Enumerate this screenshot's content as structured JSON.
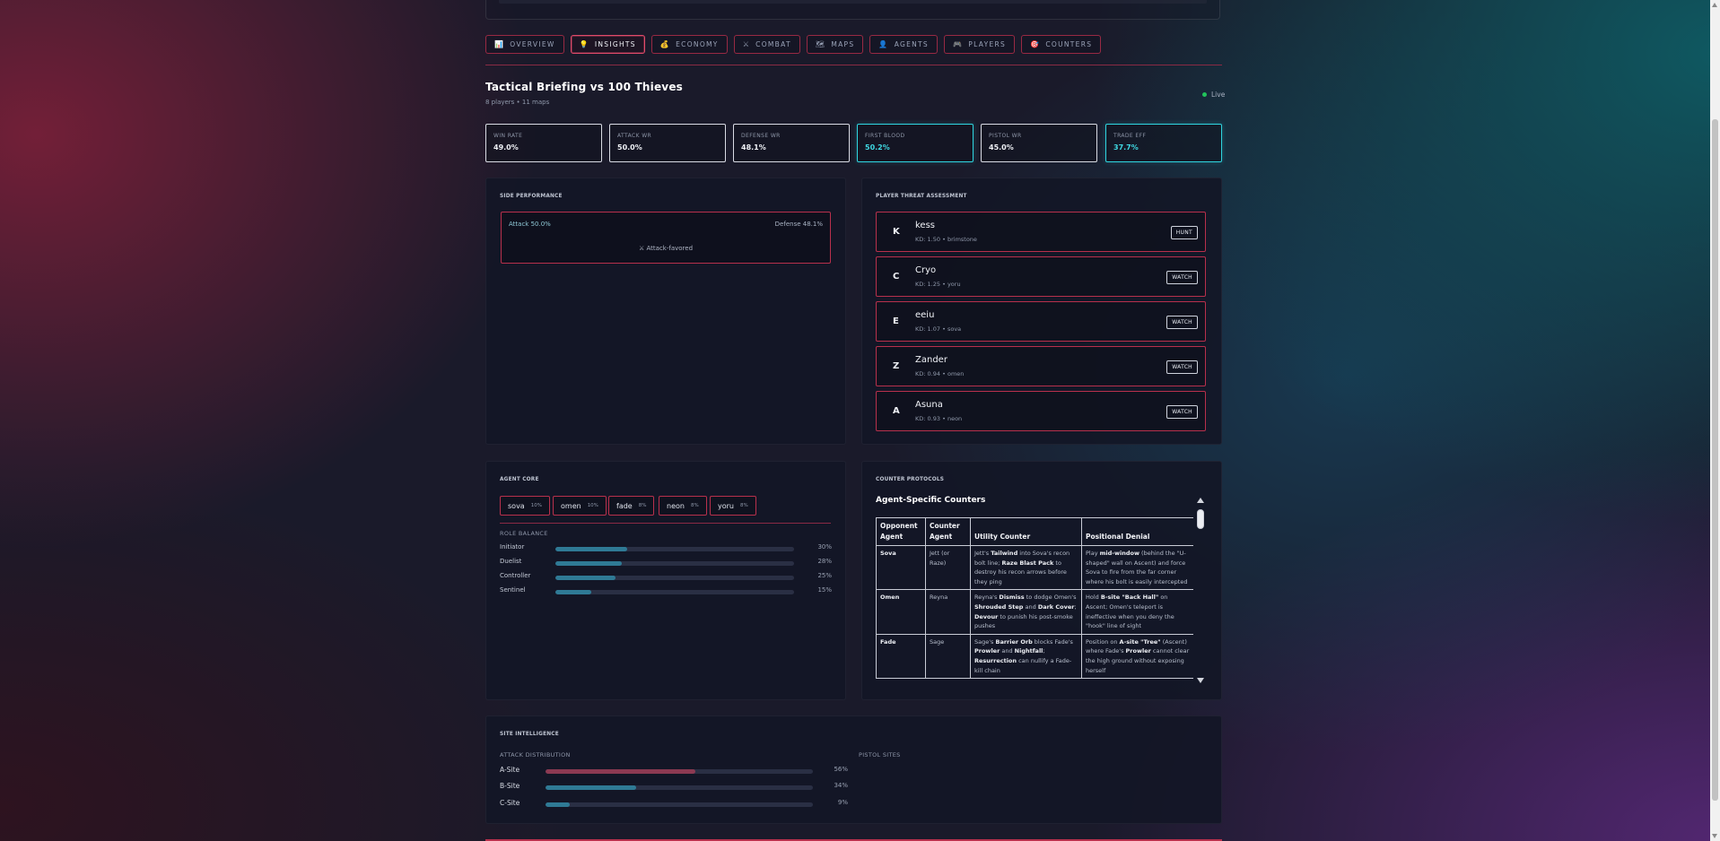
{
  "tabs": [
    {
      "icon": "📊",
      "label": "OVERVIEW",
      "active": false
    },
    {
      "icon": "💡",
      "label": "INSIGHTS",
      "active": true
    },
    {
      "icon": "💰",
      "label": "ECONOMY",
      "active": false
    },
    {
      "icon": "⚔",
      "label": "COMBAT",
      "active": false
    },
    {
      "icon": "🗺",
      "label": "MAPS",
      "active": false
    },
    {
      "icon": "👤",
      "label": "AGENTS",
      "active": false
    },
    {
      "icon": "🎮",
      "label": "PLAYERS",
      "active": false
    },
    {
      "icon": "🎯",
      "label": "COUNTERS",
      "active": false
    }
  ],
  "header": {
    "title": "Tactical Briefing vs 100 Thieves",
    "subtitle": "8 players • 11 maps",
    "live_label": "Live",
    "live_color": "#22c35b"
  },
  "stats": [
    {
      "label": "WIN RATE",
      "value": "49.0%",
      "highlight": false
    },
    {
      "label": "ATTACK WR",
      "value": "50.0%",
      "highlight": false
    },
    {
      "label": "DEFENSE WR",
      "value": "48.1%",
      "highlight": false
    },
    {
      "label": "FIRST BLOOD",
      "value": "50.2%",
      "highlight": true
    },
    {
      "label": "PISTOL WR",
      "value": "45.0%",
      "highlight": false
    },
    {
      "label": "TRADE EFF",
      "value": "37.7%",
      "highlight": true
    }
  ],
  "side_performance": {
    "title": "SIDE PERFORMANCE",
    "attack": "Attack 50.0%",
    "defense": "Defense 48.1%",
    "verdict": "⚔ Attack-favored"
  },
  "threats": {
    "title": "PLAYER THREAT ASSESSMENT",
    "players": [
      {
        "initial": "K",
        "name": "kess",
        "kd": "KD: 1.50 • brimstone",
        "tag": "HUNT"
      },
      {
        "initial": "C",
        "name": "Cryo",
        "kd": "KD: 1.25 • yoru",
        "tag": "WATCH"
      },
      {
        "initial": "E",
        "name": "eeiu",
        "kd": "KD: 1.07 • sova",
        "tag": "WATCH"
      },
      {
        "initial": "Z",
        "name": "Zander",
        "kd": "KD: 0.94 • omen",
        "tag": "WATCH"
      },
      {
        "initial": "A",
        "name": "Asuna",
        "kd": "KD: 0.93 • neon",
        "tag": "WATCH"
      }
    ]
  },
  "agent_core": {
    "title": "AGENT CORE",
    "agents": [
      {
        "name": "sova",
        "pct": "10%"
      },
      {
        "name": "omen",
        "pct": "10%"
      },
      {
        "name": "fade",
        "pct": "8%"
      },
      {
        "name": "neon",
        "pct": "8%"
      },
      {
        "name": "yoru",
        "pct": "8%"
      }
    ],
    "role_balance_label": "ROLE BALANCE",
    "roles": [
      {
        "name": "Initiator",
        "pct": "30%",
        "value": 30
      },
      {
        "name": "Duelist",
        "pct": "28%",
        "value": 28
      },
      {
        "name": "Controller",
        "pct": "25%",
        "value": 25
      },
      {
        "name": "Sentinel",
        "pct": "15%",
        "value": 15
      }
    ]
  },
  "counters": {
    "title": "COUNTER PROTOCOLS",
    "table_title": "Agent-Specific Counters",
    "headers": [
      "Opponent Agent",
      "Counter Agent",
      "Utility Counter",
      "Positional Denial"
    ],
    "rows": [
      {
        "opponent": "Sova",
        "counter": "Jett (or Raze)",
        "utility": "Jett's <b>Tailwind</b> into Sova's recon bolt line; <b>Raze Blast Pack</b> to destroy his recon arrows before they ping",
        "positional": "Play <b>mid-window</b> (behind the \"U-shaped\" wall on Ascent) and force Sova to fire from the far corner where his bolt is easily intercepted"
      },
      {
        "opponent": "Omen",
        "counter": "Reyna",
        "utility": "Reyna's <b>Dismiss</b> to dodge Omen's <b>Shrouded Step</b> and <b>Dark Cover</b>; <b>Devour</b> to punish his post-smoke pushes",
        "positional": "Hold <b>B-site \"Back Hall\"</b> on Ascent; Omen's teleport is ineffective when you deny the \"hook\" line of sight"
      },
      {
        "opponent": "Fade",
        "counter": "Sage",
        "utility": "Sage's <b>Barrier Orb</b> blocks Fade's <b>Prowler</b> and <b>Nightfall</b>; <b>Resurrection</b> can nullify a Fade-kill chain",
        "positional": "Position on <b>A-site \"Tree\"</b> (Ascent) where Fade's <b>Prowler</b> cannot clear the high ground without exposing herself"
      }
    ]
  },
  "site_intel": {
    "title": "SITE INTELLIGENCE",
    "attack_label": "ATTACK DISTRIBUTION",
    "pistol_label": "PISTOL SITES",
    "sites": [
      {
        "name": "A-Site",
        "pct": "56%",
        "value": 56,
        "color": "#8c3a52"
      },
      {
        "name": "B-Site",
        "pct": "34%",
        "value": 34,
        "color": "#2f7a95"
      },
      {
        "name": "C-Site",
        "pct": "9%",
        "value": 9,
        "color": "#2f7a95"
      }
    ]
  },
  "colors": {
    "accent_red": "#b8304c",
    "accent_cyan": "#2fd5e0",
    "bar_teal": "#2f7a95"
  }
}
